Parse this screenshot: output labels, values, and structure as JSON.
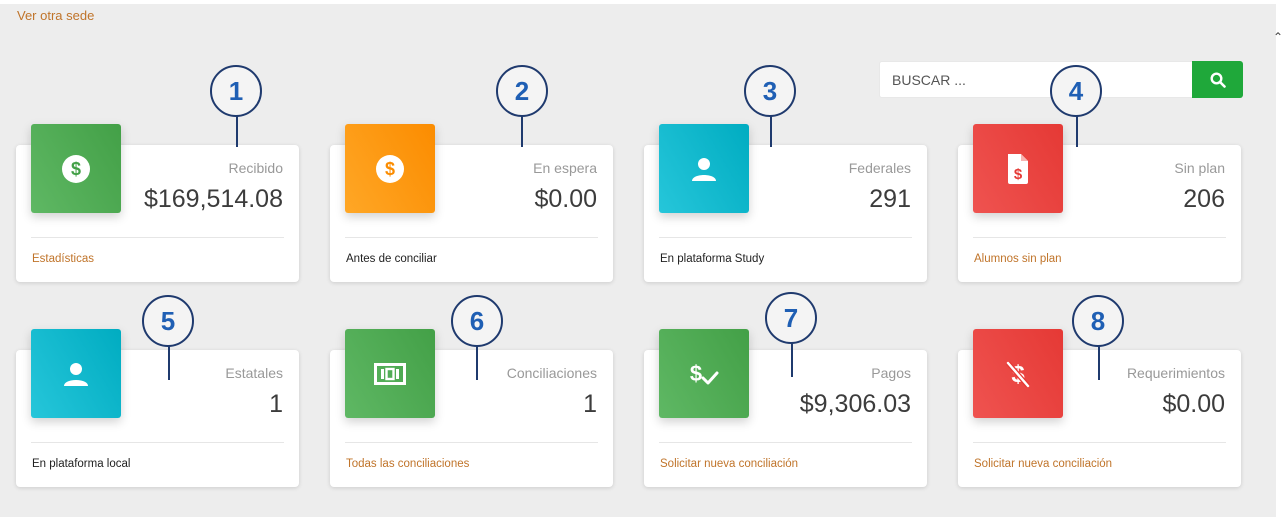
{
  "header": {
    "other_site_link": "Ver otra sede"
  },
  "search": {
    "placeholder": "BUSCAR ...",
    "button_icon": "search-icon"
  },
  "cards": [
    {
      "label": "Recibido",
      "value": "$169,514.08",
      "footer": "Estadísticas",
      "icon": "dollar-circle-icon",
      "color": "#43a047"
    },
    {
      "label": "En espera",
      "value": "$0.00",
      "footer": "Antes de conciliar",
      "icon": "dollar-circle-icon",
      "color": "#fb8c00"
    },
    {
      "label": "Federales",
      "value": "291",
      "footer": "En plataforma Study",
      "icon": "person-icon",
      "color": "#00acc1"
    },
    {
      "label": "Sin plan",
      "value": "206",
      "footer": "Alumnos sin plan",
      "icon": "dollar-document-icon",
      "color": "#e53935"
    },
    {
      "label": "Estatales",
      "value": "1",
      "footer": "En plataforma local",
      "icon": "person-icon",
      "color": "#00acc1"
    },
    {
      "label": "Conciliaciones",
      "value": "1",
      "footer": "Todas las conciliaciones",
      "icon": "money-bill-icon",
      "color": "#43a047"
    },
    {
      "label": "Pagos",
      "value": "$9,306.03",
      "footer": "Solicitar nueva conciliación",
      "icon": "dollar-check-icon",
      "color": "#43a047"
    },
    {
      "label": "Requerimientos",
      "value": "$0.00",
      "footer": "Solicitar nueva conciliación",
      "icon": "dollar-slash-icon",
      "color": "#e53935"
    }
  ],
  "callouts": [
    "1",
    "2",
    "3",
    "4",
    "5",
    "6",
    "7",
    "8"
  ]
}
